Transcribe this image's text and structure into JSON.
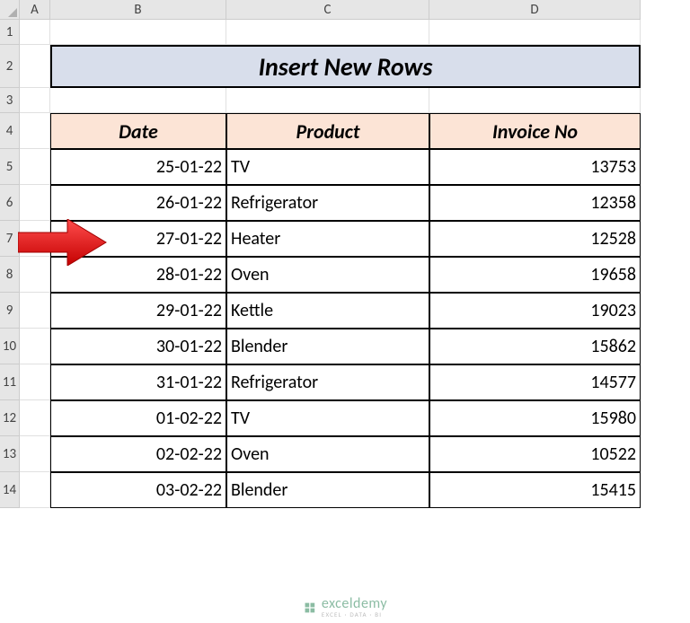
{
  "columns": {
    "a": "A",
    "b": "B",
    "c": "C",
    "d": "D"
  },
  "rowLabels": [
    "1",
    "2",
    "3",
    "4",
    "5",
    "6",
    "7",
    "8",
    "9",
    "10",
    "11",
    "12",
    "13",
    "14"
  ],
  "title": "Insert New Rows",
  "headers": {
    "date": "Date",
    "product": "Product",
    "invoice": "Invoice No"
  },
  "rows": [
    {
      "date": "25-01-22",
      "product": "TV",
      "invoice": "13753"
    },
    {
      "date": "26-01-22",
      "product": "Refrigerator",
      "invoice": "12358"
    },
    {
      "date": "27-01-22",
      "product": "Heater",
      "invoice": "12528"
    },
    {
      "date": "28-01-22",
      "product": "Oven",
      "invoice": "19658"
    },
    {
      "date": "29-01-22",
      "product": "Kettle",
      "invoice": "19023"
    },
    {
      "date": "30-01-22",
      "product": "Blender",
      "invoice": "15862"
    },
    {
      "date": "31-01-22",
      "product": "Refrigerator",
      "invoice": "14577"
    },
    {
      "date": "01-02-22",
      "product": "TV",
      "invoice": "15980"
    },
    {
      "date": "02-02-22",
      "product": "Oven",
      "invoice": "10522"
    },
    {
      "date": "03-02-22",
      "product": "Blender",
      "invoice": "15415"
    }
  ],
  "watermark": {
    "brand": "exceldemy",
    "tagline": "EXCEL · DATA · BI"
  }
}
